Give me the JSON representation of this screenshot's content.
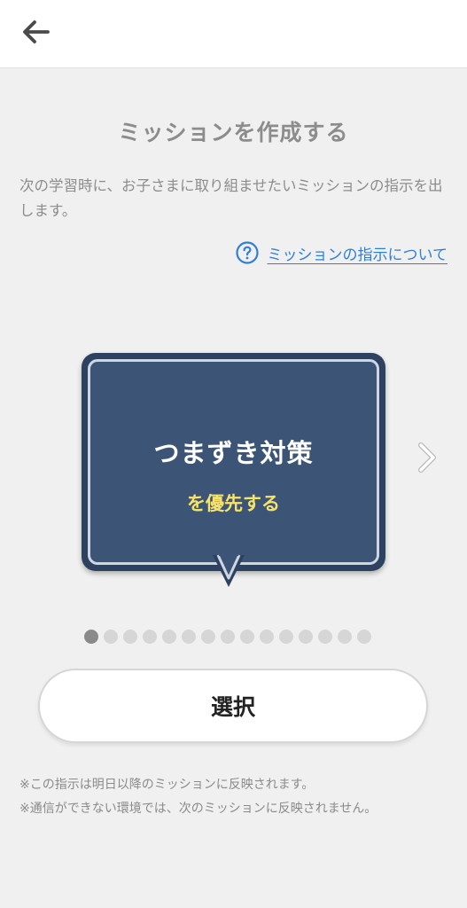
{
  "header": {
    "back_icon": "arrow-left-icon"
  },
  "page": {
    "title": "ミッションを作成する",
    "description": "次の学習時に、お子さまに取り組ませたいミッションの指示を出します。",
    "help_link": "ミッションの指示について",
    "help_icon": "question-circle-icon"
  },
  "carousel": {
    "card_title": "つまずき対策",
    "card_subtitle": "を優先する",
    "next_icon": "chevron-right-icon",
    "current_page": 1,
    "total_pages": 15
  },
  "actions": {
    "select_label": "選択"
  },
  "notes": [
    "※この指示は明日以降のミッションに反映されます。",
    "※通信ができない環境では、次のミッションに反映されません。"
  ],
  "colors": {
    "card_background": "#3c5475",
    "card_subtitle": "#f6e36a",
    "link": "#2f7fd8",
    "dot_active": "#8a8a8a",
    "dot_inactive": "#d6d6d6"
  }
}
